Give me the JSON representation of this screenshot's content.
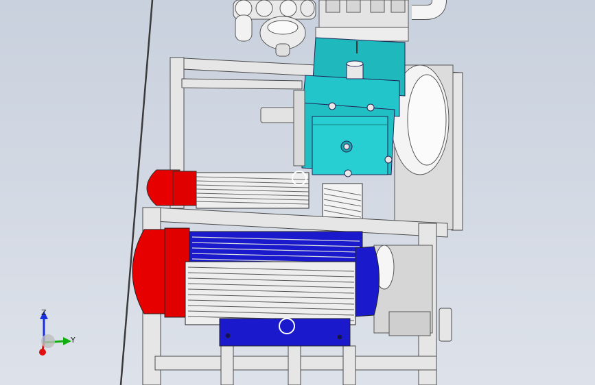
{
  "viewport": {
    "background_top": "#c9d1de",
    "background_bottom": "#dde2ea"
  },
  "model": {
    "frame_color": "#e6e6e6",
    "pump_color": "#20c0c4",
    "motor_end_color": "#e60000",
    "motor_body_color": "#1a1acc",
    "fin_color": "#f2f2f2"
  },
  "triad": {
    "z_label": "Z",
    "y_label": "Y",
    "z_color": "#1a2fe0",
    "y_color": "#10b010",
    "x_color": "#e01010"
  }
}
